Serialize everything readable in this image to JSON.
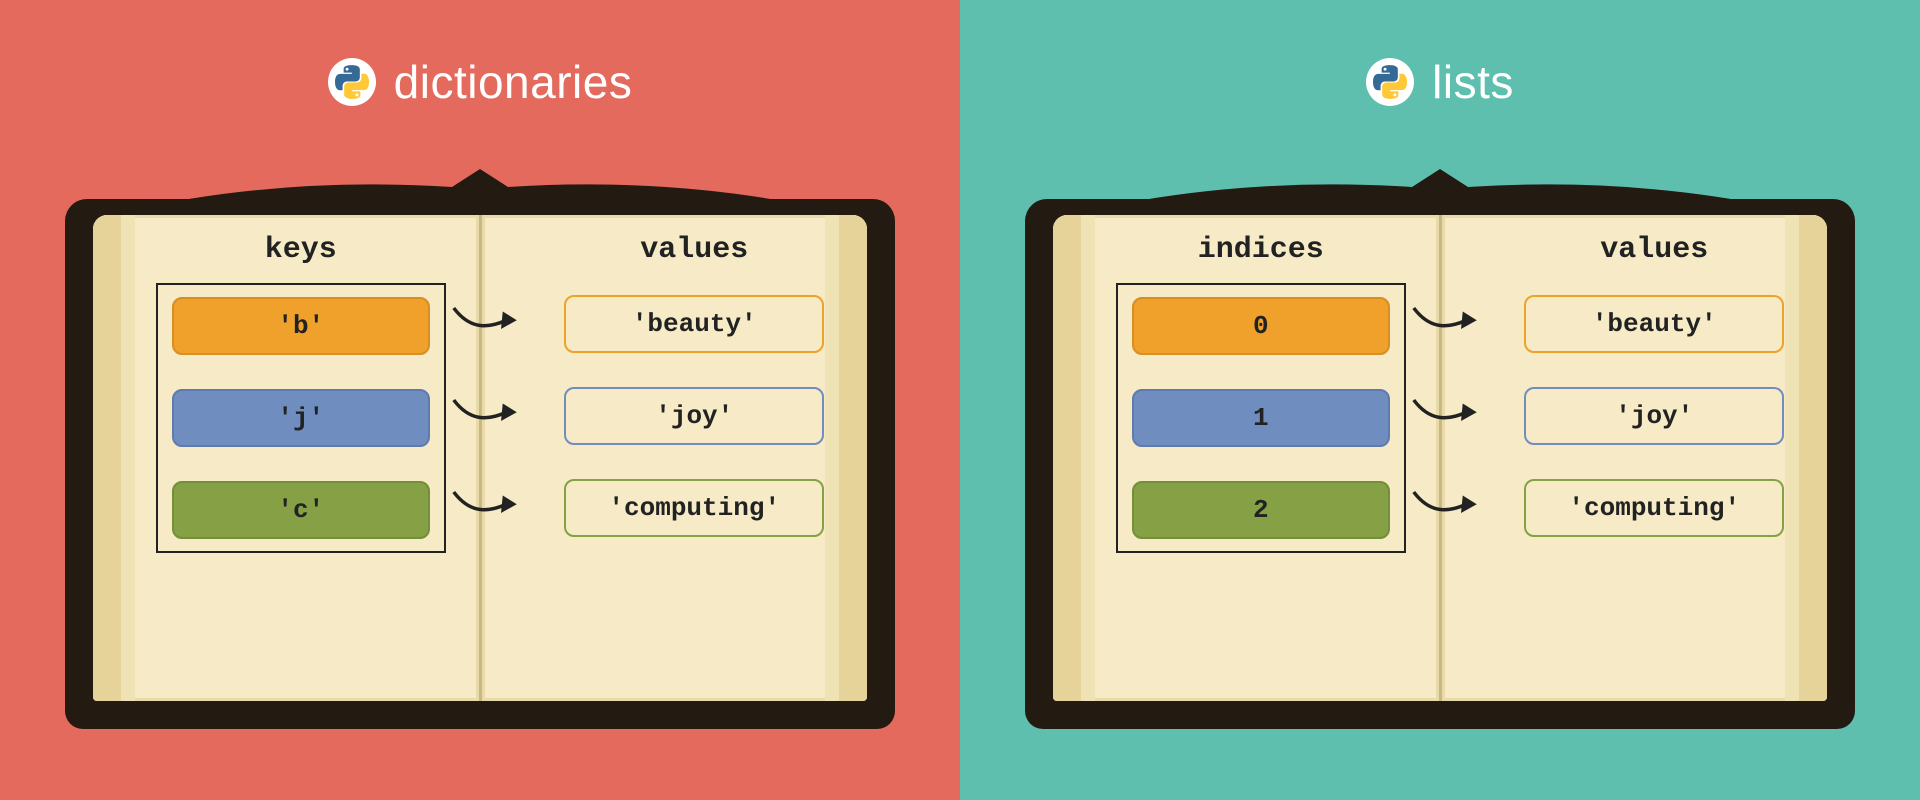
{
  "left": {
    "title": "dictionaries",
    "left_col_header": "keys",
    "right_col_header": "values",
    "rows": [
      {
        "key": "'b'",
        "value": "'beauty'",
        "color": "orange"
      },
      {
        "key": "'j'",
        "value": "'joy'",
        "color": "blue"
      },
      {
        "key": "'c'",
        "value": "'computing'",
        "color": "green"
      }
    ]
  },
  "right": {
    "title": "lists",
    "left_col_header": "indices",
    "right_col_header": "values",
    "rows": [
      {
        "key": "0",
        "value": "'beauty'",
        "color": "orange"
      },
      {
        "key": "1",
        "value": "'joy'",
        "color": "blue"
      },
      {
        "key": "2",
        "value": "'computing'",
        "color": "green"
      }
    ]
  },
  "colors": {
    "bg_left": "#E36A5C",
    "bg_right": "#5FBFAF",
    "book_cover": "#231A12",
    "page": "#F6EBC6",
    "orange": "#EFA12B",
    "blue": "#6F8DBF",
    "green": "#85A045"
  }
}
